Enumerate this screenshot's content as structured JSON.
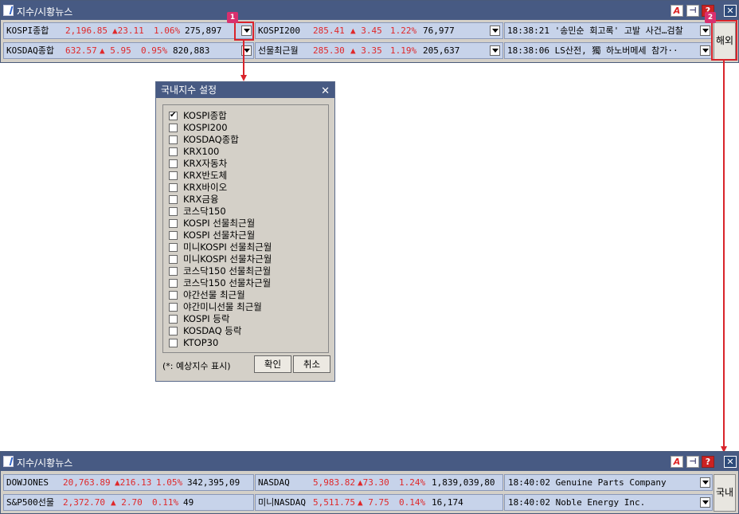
{
  "top_window": {
    "title": "지수/시황뉴스",
    "rows": [
      {
        "name": "KOSPI종합",
        "price": "2,196.85",
        "change": "▲23.11",
        "pct": "1.06%",
        "volume": "275,897",
        "name2": "KOSPI200",
        "price2": "285.41",
        "change2": "▲ 3.45",
        "pct2": "1.22%",
        "volume2": "76,977",
        "news": "18:38:21 '송민순 회고록' 고발 사건…검찰"
      },
      {
        "name": "KOSDAQ종합",
        "price": "632.57",
        "change": "▲ 5.95",
        "pct": "0.95%",
        "volume": "820,883",
        "name2": "선물최근월",
        "price2": "285.30",
        "change2": "▲ 3.35",
        "pct2": "1.19%",
        "volume2": "205,637",
        "news": "18:38:06 LS산전, 獨 하노버메세 참가··"
      }
    ],
    "side_button": "해외"
  },
  "bottom_window": {
    "title": "지수/시황뉴스",
    "rows": [
      {
        "name": "DOWJONES",
        "price": "20,763.89",
        "change": "▲216.13",
        "pct": "1.05%",
        "volume": "342,395,09",
        "name2": "NASDAQ",
        "price2": "5,983.82",
        "change2": "▲73.30",
        "pct2": "1.24%",
        "volume2": "1,839,039,80",
        "news": "18:40:02 Genuine Parts Company"
      },
      {
        "name": "S&P500선물",
        "price": "2,372.70",
        "change": "▲ 2.70",
        "pct": "0.11%",
        "volume": "49",
        "name2": "미니NASDAQ",
        "price2": "5,511.75",
        "change2": "▲ 7.75",
        "pct2": "0.14%",
        "volume2": "16,174",
        "news": "18:40:02 Noble Energy Inc."
      }
    ],
    "side_button": "국내"
  },
  "titlebar_buttons": {
    "font": "A",
    "pin": "⊣",
    "help": "?",
    "close": "✕"
  },
  "callouts": {
    "badge1": "1",
    "badge2": "2"
  },
  "dialog": {
    "title": "국내지수 설정",
    "close": "✕",
    "options": [
      {
        "label": "KOSPI종합",
        "checked": true
      },
      {
        "label": "KOSPI200",
        "checked": false
      },
      {
        "label": "KOSDAQ종합",
        "checked": false
      },
      {
        "label": "KRX100",
        "checked": false
      },
      {
        "label": "KRX자동차",
        "checked": false
      },
      {
        "label": "KRX반도체",
        "checked": false
      },
      {
        "label": "KRX바이오",
        "checked": false
      },
      {
        "label": "KRX금융",
        "checked": false
      },
      {
        "label": "코스닥150",
        "checked": false
      },
      {
        "label": "KOSPI 선물최근월",
        "checked": false
      },
      {
        "label": "KOSPI 선물차근월",
        "checked": false
      },
      {
        "label": "미니KOSPI 선물최근월",
        "checked": false
      },
      {
        "label": "미니KOSPI 선물차근월",
        "checked": false
      },
      {
        "label": "코스닥150 선물최근월",
        "checked": false
      },
      {
        "label": "코스닥150 선물차근월",
        "checked": false
      },
      {
        "label": "야간선물 최근월",
        "checked": false
      },
      {
        "label": "야간미니선물 최근월",
        "checked": false
      },
      {
        "label": "KOSPI 등락",
        "checked": false
      },
      {
        "label": "KOSDAQ 등락",
        "checked": false
      },
      {
        "label": "KTOP30",
        "checked": false
      }
    ],
    "note": "(*: 예상지수 표시)",
    "ok_label": "확인",
    "cancel_label": "취소"
  },
  "colors": {
    "up": "#e0282a",
    "cell_bg": "#c7d3ea",
    "titlebar": "#475a83",
    "callout": "#d9242b",
    "badge": "#d9306e"
  }
}
